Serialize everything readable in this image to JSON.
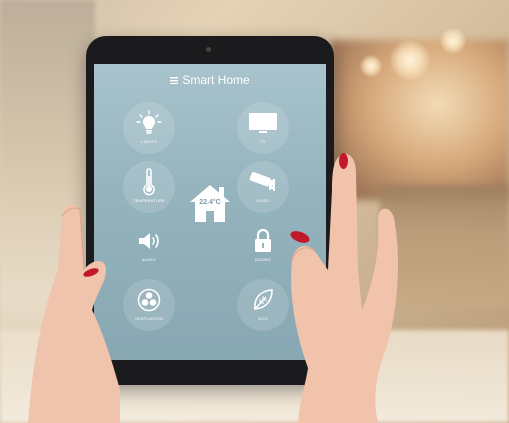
{
  "app": {
    "title": "Smart Home"
  },
  "center": {
    "temperature": "22.4°C"
  },
  "tiles": [
    {
      "id": "lights",
      "label": "LIGHTS",
      "icon": "lightbulb-icon"
    },
    {
      "id": "tv",
      "label": "TV",
      "icon": "tv-icon"
    },
    {
      "id": "temperature",
      "label": "TEMPERATURE",
      "icon": "thermometer-icon"
    },
    {
      "id": "video",
      "label": "VIDEO",
      "icon": "security-camera-icon"
    },
    {
      "id": "audio",
      "label": "AUDIO",
      "icon": "speaker-icon"
    },
    {
      "id": "doors",
      "label": "DOORS",
      "icon": "padlock-icon"
    },
    {
      "id": "ventilation",
      "label": "VENTILATION",
      "icon": "fan-icon"
    },
    {
      "id": "eco",
      "label": "ECO",
      "icon": "leaf-icon"
    }
  ],
  "colors": {
    "screen": "#94b3bd",
    "bezel": "#1b1b1d",
    "icon": "#ffffff",
    "nail": "#c2182b"
  }
}
